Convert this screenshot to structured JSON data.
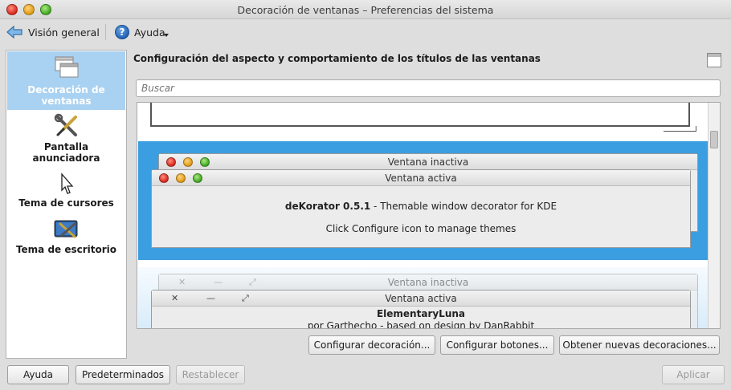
{
  "window": {
    "title": "Decoración de ventanas – Preferencias del sistema"
  },
  "toolbar": {
    "back_label": "Visión general",
    "help_label": "Ayuda"
  },
  "sidebar": {
    "items": [
      {
        "label": "Decoración de ventanas",
        "icon": "window-decoration-icon",
        "selected": true
      },
      {
        "label": "Pantalla anunciadora",
        "icon": "tools-icon",
        "selected": false
      },
      {
        "label": "Tema de cursores",
        "icon": "cursor-icon",
        "selected": false
      },
      {
        "label": "Tema de escritorio",
        "icon": "desktop-theme-icon",
        "selected": false
      }
    ]
  },
  "main": {
    "heading": "Configuración del aspecto y comportamiento de los títulos de las ventanas",
    "search_placeholder": "Buscar",
    "decorations": [
      {
        "inactive_title": "Ventana inactiva",
        "active_title": "Ventana activa",
        "name": "deKorator 0.5.1",
        "description": " - Themable window decorator for KDE",
        "hint": "Click Configure icon to manage themes"
      },
      {
        "inactive_title": "Ventana inactiva",
        "active_title": "Ventana activa",
        "name": "ElementaryLuna",
        "author": "por Garthecho - based on design by DanRabbit"
      }
    ],
    "buttons": {
      "configure_decoration": "Configurar decoración...",
      "configure_buttons": "Configurar botones...",
      "get_new": "Obtener nuevas decoraciones..."
    }
  },
  "footer": {
    "help": "Ayuda",
    "defaults": "Predeterminados",
    "reset": "Restablecer",
    "apply": "Aplicar"
  },
  "colors": {
    "selection": "#3b9ee0",
    "sidebar_selection": "#a9d1f1"
  }
}
